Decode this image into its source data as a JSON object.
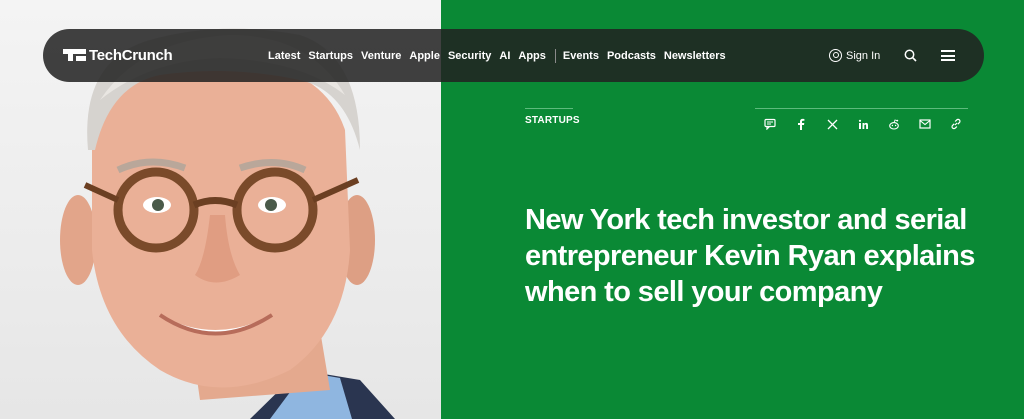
{
  "brand": {
    "logo_text": "TechCrunch"
  },
  "nav": {
    "links": [
      "Latest",
      "Startups",
      "Venture",
      "Apple",
      "Security",
      "AI",
      "Apps"
    ],
    "secondary_links": [
      "Events",
      "Podcasts",
      "Newsletters"
    ],
    "sign_in": "Sign In"
  },
  "article": {
    "category": "STARTUPS",
    "headline": "New York tech investor and serial entrepreneur Kevin Ryan explains when to sell your company"
  },
  "share_icons": [
    "comment-icon",
    "facebook-icon",
    "x-icon",
    "linkedin-icon",
    "reddit-icon",
    "email-icon",
    "link-icon"
  ],
  "colors": {
    "panel_green": "#0a8935",
    "nav_bg": "#222222",
    "text": "#ffffff"
  }
}
